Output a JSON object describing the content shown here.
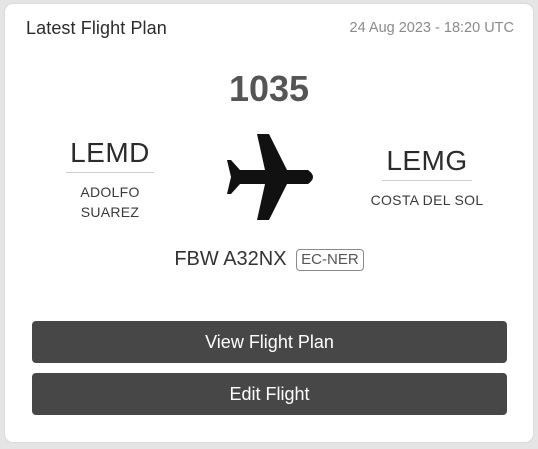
{
  "card": {
    "title": "Latest Flight Plan",
    "timestamp": "24 Aug 2023 - 18:20 UTC"
  },
  "flight": {
    "number": "1035",
    "origin": {
      "code": "LEMD",
      "name_line1": "ADOLFO",
      "name_line2": "SUAREZ"
    },
    "destination": {
      "code": "LEMG",
      "name": "COSTA DEL SOL"
    },
    "aircraft": {
      "type": "FBW A32NX",
      "registration": "EC-NER"
    },
    "icon": "airplane-icon"
  },
  "actions": {
    "view_label": "View Flight Plan",
    "edit_label": "Edit Flight"
  },
  "colors": {
    "button_bg": "#474747",
    "button_text": "#ffffff",
    "card_bg": "#ffffff",
    "page_bg": "#e5e5e5"
  }
}
